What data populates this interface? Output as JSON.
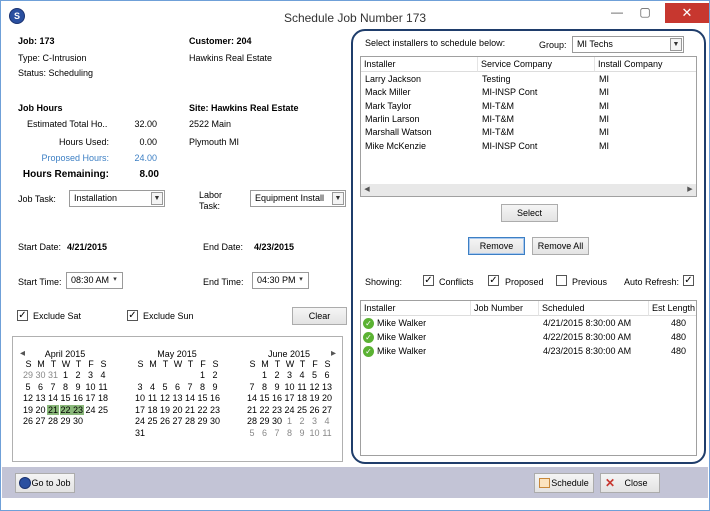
{
  "window": {
    "title": "Schedule Job Number 173",
    "minimize": "—",
    "maximize": "▢",
    "close": "✕"
  },
  "job": {
    "job": "Job: 173",
    "type": "Type: C-Intrusion",
    "status": "Status: Scheduling",
    "customer": "Customer: 204",
    "customer_name": "Hawkins Real Estate"
  },
  "hours": {
    "heading": "Job Hours",
    "est_label": "Estimated Total Ho..",
    "est_value": "32.00",
    "used_label": "Hours Used:",
    "used_value": "0.00",
    "proposed_label": "Proposed Hours:",
    "proposed_value": "24.00",
    "remaining_label": "Hours Remaining:",
    "remaining_value": "8.00"
  },
  "site": {
    "heading": "Site: Hawkins Real Estate",
    "address1": "2522 Main",
    "address2": "Plymouth MI"
  },
  "task": {
    "job_task_label": "Job Task:",
    "job_task_value": "Installation",
    "labor_task_label1": "Labor",
    "labor_task_label2": "Task:",
    "labor_task_value": "Equipment Install"
  },
  "dates": {
    "start_date_label": "Start Date:",
    "start_date": "4/21/2015",
    "end_date_label": "End Date:",
    "end_date": "4/23/2015",
    "start_time_label": "Start Time:",
    "start_time": "08:30 AM",
    "end_time_label": "End Time:",
    "end_time": "04:30 PM",
    "exclude_sat": "Exclude Sat",
    "exclude_sun": "Exclude Sun",
    "clear": "Clear"
  },
  "calendar": {
    "prev": "◂",
    "next": "▸",
    "dow": [
      "S",
      "M",
      "T",
      "W",
      "T",
      "F",
      "S"
    ],
    "months": [
      {
        "name": "April 2015",
        "rows": [
          [
            "29",
            "30",
            "31",
            "1",
            "2",
            "3",
            "4"
          ],
          [
            "5",
            "6",
            "7",
            "8",
            "9",
            "10",
            "11"
          ],
          [
            "12",
            "13",
            "14",
            "15",
            "16",
            "17",
            "18"
          ],
          [
            "19",
            "20",
            "21",
            "22",
            "23",
            "24",
            "25"
          ],
          [
            "26",
            "27",
            "28",
            "29",
            "30",
            "",
            ""
          ]
        ]
      },
      {
        "name": "May 2015",
        "rows": [
          [
            "",
            "",
            "",
            "",
            "",
            "1",
            "2"
          ],
          [
            "3",
            "4",
            "5",
            "6",
            "7",
            "8",
            "9"
          ],
          [
            "10",
            "11",
            "12",
            "13",
            "14",
            "15",
            "16"
          ],
          [
            "17",
            "18",
            "19",
            "20",
            "21",
            "22",
            "23"
          ],
          [
            "24",
            "25",
            "26",
            "27",
            "28",
            "29",
            "30"
          ],
          [
            "31",
            "",
            "",
            "",
            "",
            "",
            ""
          ]
        ]
      },
      {
        "name": "June 2015",
        "rows": [
          [
            "",
            "1",
            "2",
            "3",
            "4",
            "5",
            "6"
          ],
          [
            "7",
            "8",
            "9",
            "10",
            "11",
            "12",
            "13"
          ],
          [
            "14",
            "15",
            "16",
            "17",
            "18",
            "19",
            "20"
          ],
          [
            "21",
            "22",
            "23",
            "24",
            "25",
            "26",
            "27"
          ],
          [
            "28",
            "29",
            "30",
            "1",
            "2",
            "3",
            "4"
          ],
          [
            "5",
            "6",
            "7",
            "8",
            "9",
            "10",
            "11"
          ]
        ]
      }
    ]
  },
  "installers": {
    "prompt": "Select installers to schedule below:",
    "group_label": "Group:",
    "group_value": "MI Techs",
    "columns": [
      "Installer",
      "Service Company",
      "Install Company"
    ],
    "rows": [
      [
        "Larry Jackson",
        "Testing",
        "MI"
      ],
      [
        "Mack Miller",
        "MI-INSP Cont",
        "MI"
      ],
      [
        "Mark Taylor",
        "MI-T&M",
        "MI"
      ],
      [
        "Marlin Larson",
        "MI-T&M",
        "MI"
      ],
      [
        "Marshall Watson",
        "MI-T&M",
        "MI"
      ],
      [
        "Mike McKenzie",
        "MI-INSP Cont",
        "MI"
      ]
    ],
    "select": "Select",
    "remove": "Remove",
    "remove_all": "Remove All"
  },
  "showing": {
    "label": "Showing:",
    "conflicts": "Conflicts",
    "proposed": "Proposed",
    "previous": "Previous",
    "auto_refresh": "Auto Refresh:"
  },
  "schedule": {
    "columns": [
      "Installer",
      "Job Number",
      "Scheduled",
      "Est Length"
    ],
    "rows": [
      [
        "Mike Walker",
        "",
        "4/21/2015 8:30:00 AM",
        "480"
      ],
      [
        "Mike Walker",
        "",
        "4/22/2015 8:30:00 AM",
        "480"
      ],
      [
        "Mike Walker",
        "",
        "4/23/2015 8:30:00 AM",
        "480"
      ]
    ]
  },
  "footer": {
    "go_to_job": "Go to Job",
    "schedule": "Schedule",
    "close": "Close"
  },
  "colors": {
    "accent": "#3c7fc4",
    "panel_border": "#1f3d6b",
    "selected_day": "#8ab87a",
    "footer": "#c3c4d6",
    "close_button": "#c7372f"
  }
}
